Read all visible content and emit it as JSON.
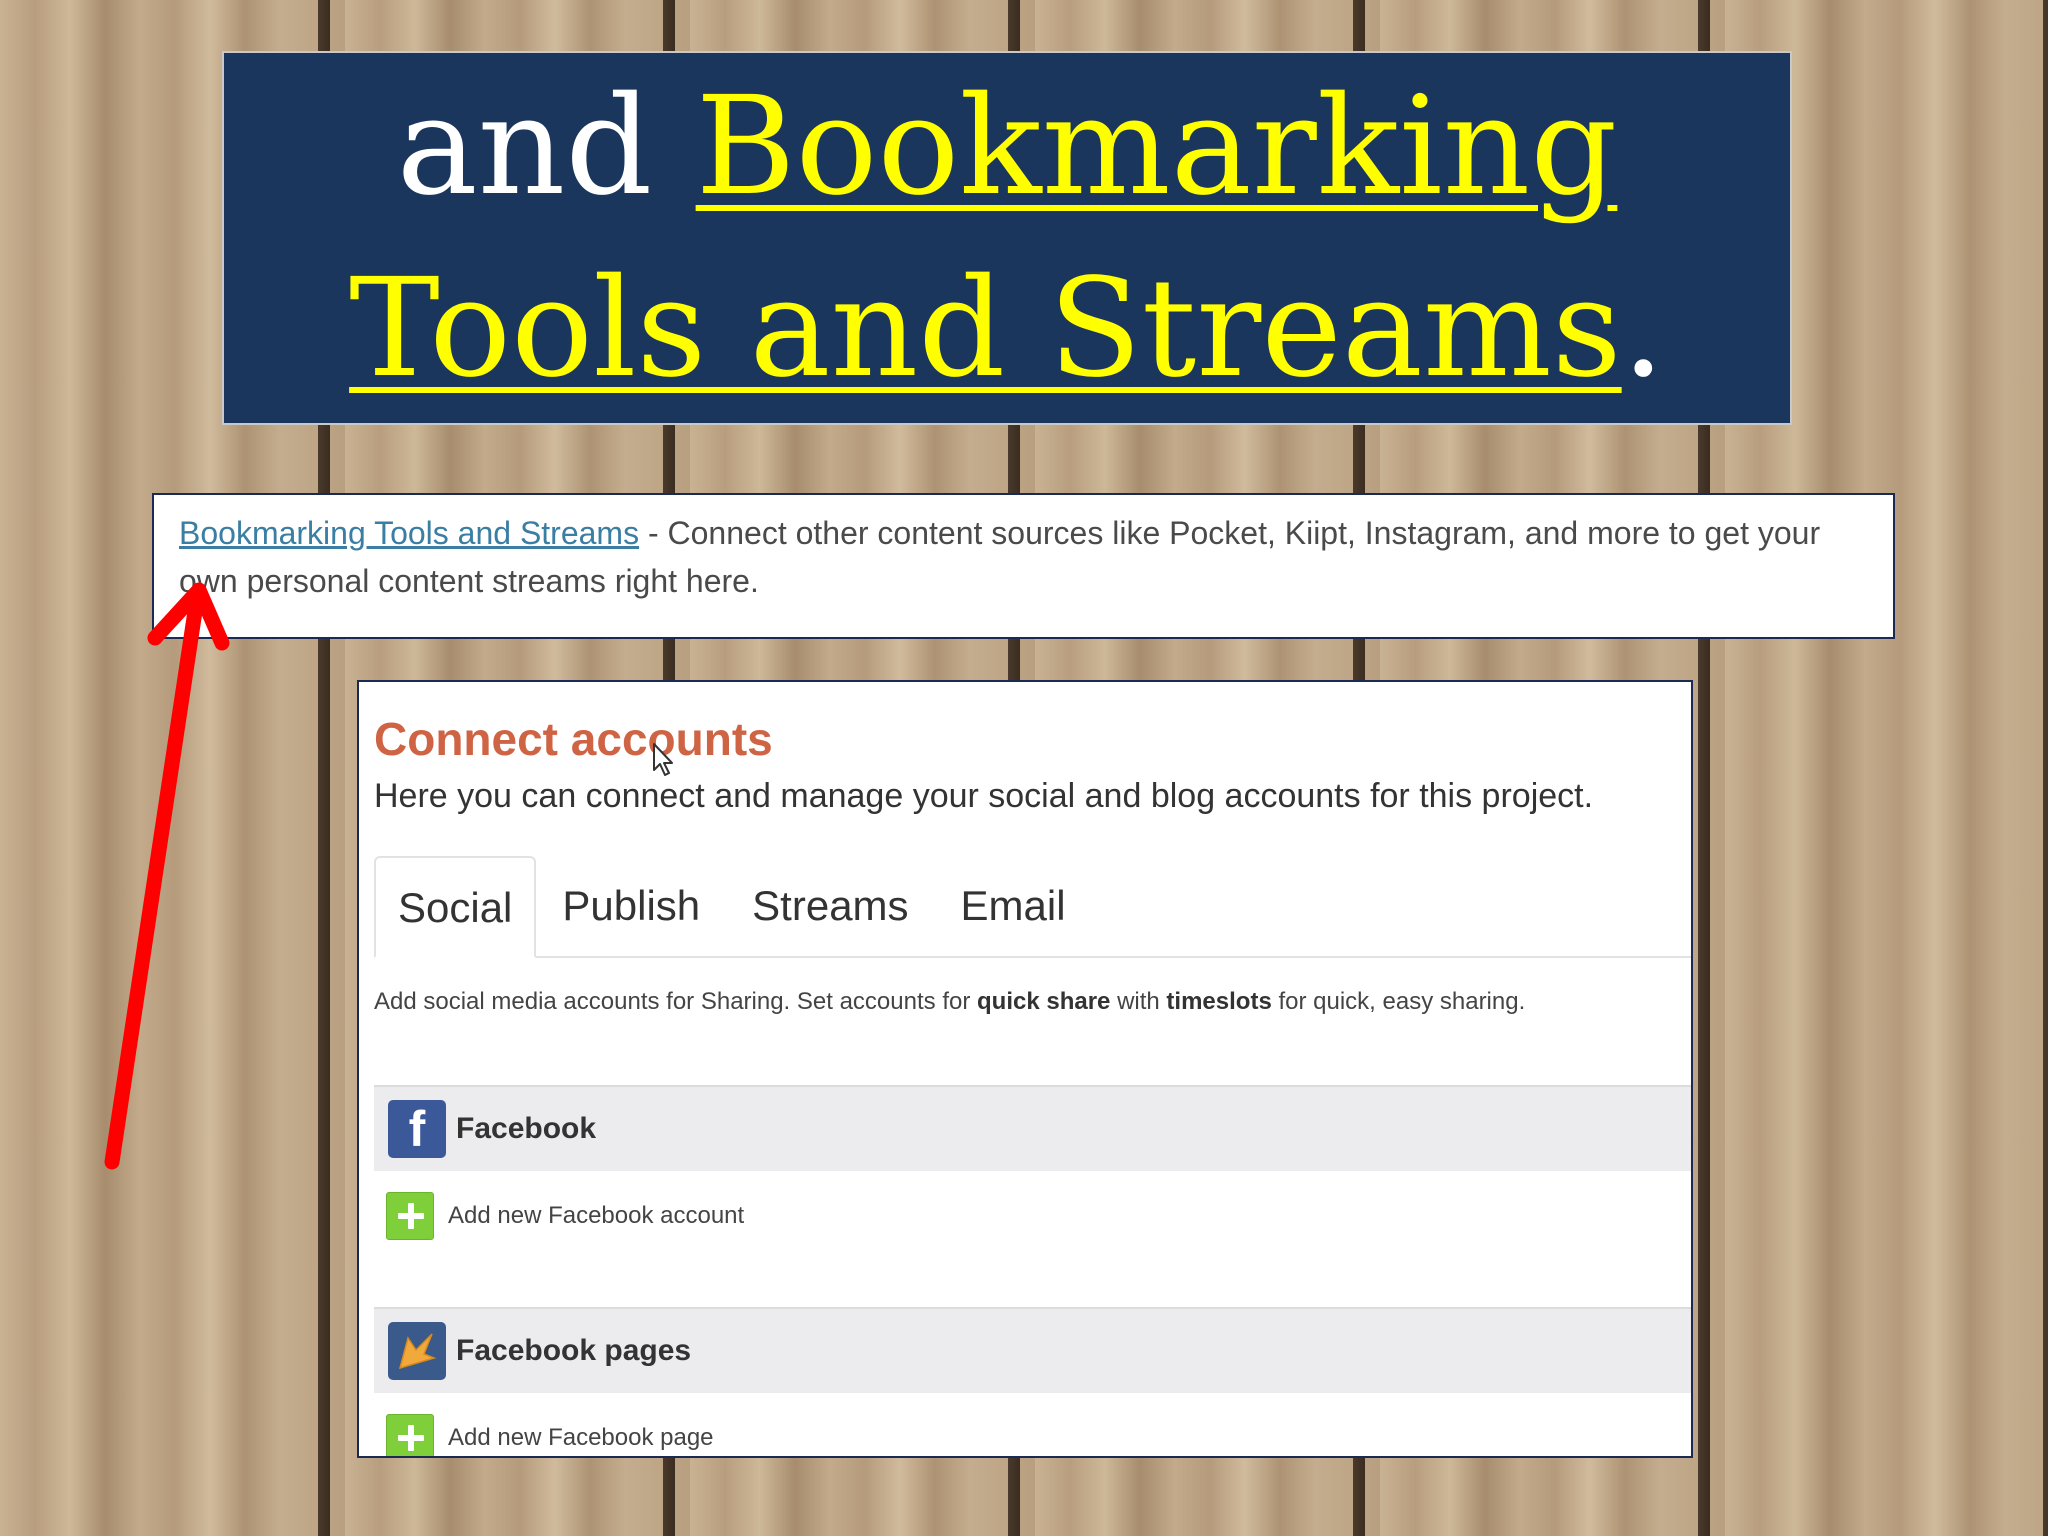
{
  "banner": {
    "line1_prefix": "and ",
    "line1_link": "Bookmarking",
    "line2_link": "Tools and Streams",
    "line2_suffix": "."
  },
  "description": {
    "link_text": "Bookmarking Tools and Streams",
    "text": " - Connect other content sources like Pocket, Kiipt, Instagram, and more to get your own personal content streams right here."
  },
  "panel": {
    "title": "Connect accounts",
    "subtitle": "Here you can connect and manage your social and blog accounts for this project.",
    "tabs": [
      {
        "label": "Social",
        "active": true
      },
      {
        "label": "Publish",
        "active": false
      },
      {
        "label": "Streams",
        "active": false
      },
      {
        "label": "Email",
        "active": false
      }
    ],
    "tab_description": {
      "part1": "Add social media accounts for Sharing. Set accounts for ",
      "bold1": "quick share",
      "part2": " with ",
      "bold2": "timeslots",
      "part3": " for quick, easy sharing."
    },
    "sections": [
      {
        "label": "Facebook",
        "icon": "facebook-icon",
        "add_label": "Add new Facebook account"
      },
      {
        "label": "Facebook pages",
        "icon": "facebook-pages-icon",
        "add_label": "Add new Facebook page"
      }
    ]
  },
  "colors": {
    "banner_bg": "#1b365d",
    "banner_highlight": "#ffff00",
    "panel_title": "#cf6445",
    "link": "#3a7ea3",
    "arrow": "#ff0000",
    "add_green": "#7fcf3a",
    "facebook_blue": "#3b5998"
  }
}
